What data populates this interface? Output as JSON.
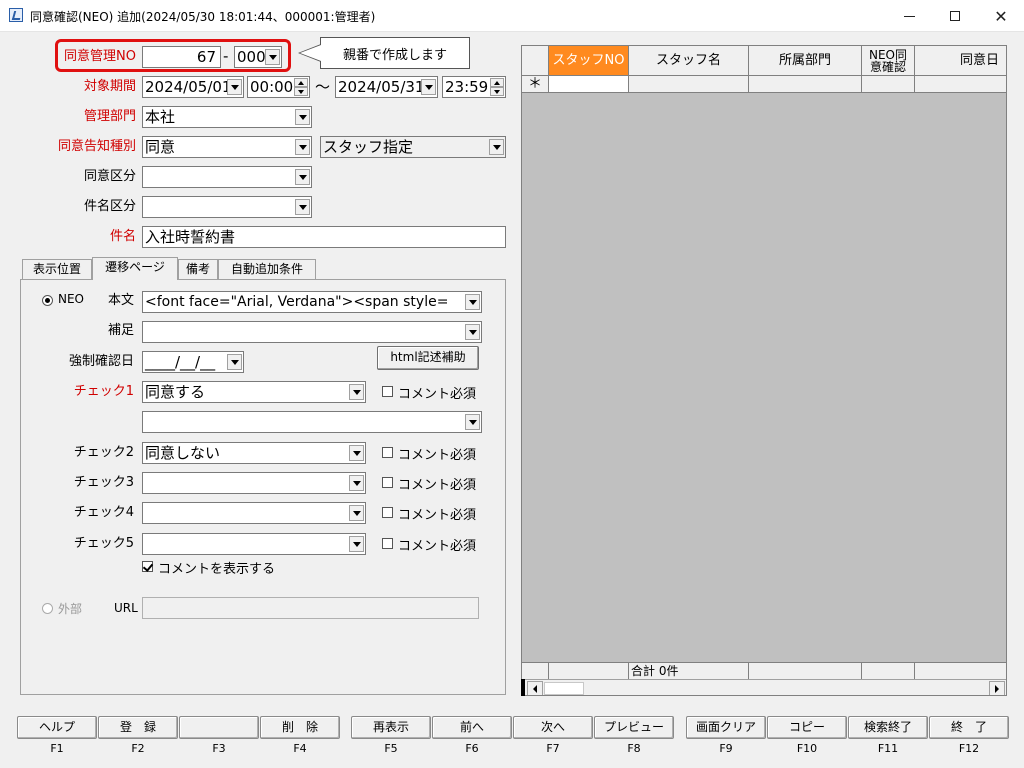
{
  "window": {
    "title": "同意確認(NEO) 追加(2024/05/30 18:01:44、000001:管理者)",
    "minimize": "—",
    "maximize": "☐",
    "close": "✕"
  },
  "form": {
    "mgmt_no_label": "同意管理NO",
    "mgmt_no_value": "67",
    "mgmt_no_sep": "-",
    "mgmt_no_sub": "000",
    "callout": "親番で作成します",
    "period_label": "対象期間",
    "period_from_date": "2024/05/01",
    "period_from_time": "00:00",
    "period_tilde": "～",
    "period_to_date": "2024/05/31",
    "period_to_time": "23:59",
    "dept_label": "管理部門",
    "dept_value": "本社",
    "notice_type_label": "同意告知種別",
    "notice_type_value": "同意",
    "staff_spec_value": "スタッフ指定",
    "consent_cat_label": "同意区分",
    "consent_cat_value": "",
    "subject_cat_label": "件名区分",
    "subject_cat_value": "",
    "subject_label": "件名",
    "subject_value": "入社時誓約書"
  },
  "tabs": [
    {
      "label": "表示位置"
    },
    {
      "label": "遷移ページ"
    },
    {
      "label": "備考"
    },
    {
      "label": "自動追加条件"
    }
  ],
  "panel": {
    "neo_label": "NEO",
    "body_label": "本文",
    "body_value": "<font face=\"Arial, Verdana\"><span style=",
    "supp_label": "補足",
    "supp_value": "",
    "force_date_label": "強制確認日",
    "force_date_value": "____/__/__",
    "html_assist": "html記述補助",
    "check1_label": "チェック1",
    "check1_value": "同意する",
    "check1_sub_value": "",
    "check2_label": "チェック2",
    "check2_value": "同意しない",
    "check3_label": "チェック3",
    "check3_value": "",
    "check4_label": "チェック4",
    "check4_value": "",
    "check5_label": "チェック5",
    "check5_value": "",
    "comment_required": "コメント必須",
    "show_comment": "コメントを表示する",
    "external_label": "外部",
    "url_label": "URL",
    "url_value": ""
  },
  "grid": {
    "headers": [
      "スタッフNO",
      "スタッフ名",
      "所属部門",
      "NEO同意確認",
      "同意日"
    ],
    "new_row_marker": "＊",
    "total": "合計 0件"
  },
  "fkeys": [
    {
      "label": "ヘルプ",
      "key": "F1"
    },
    {
      "label": "登　録",
      "key": "F2"
    },
    {
      "label": "",
      "key": "F3"
    },
    {
      "label": "削　除",
      "key": "F4"
    },
    {
      "label": "再表示",
      "key": "F5"
    },
    {
      "label": "前へ",
      "key": "F6"
    },
    {
      "label": "次へ",
      "key": "F7"
    },
    {
      "label": "プレビュー",
      "key": "F8"
    },
    {
      "label": "画面クリア",
      "key": "F9"
    },
    {
      "label": "コピー",
      "key": "F10"
    },
    {
      "label": "検索終了",
      "key": "F11"
    },
    {
      "label": "終　了",
      "key": "F12"
    }
  ],
  "colors": {
    "required_label": "#d00000",
    "highlight": "#e01010",
    "selected_header": "#ff8a1f"
  }
}
